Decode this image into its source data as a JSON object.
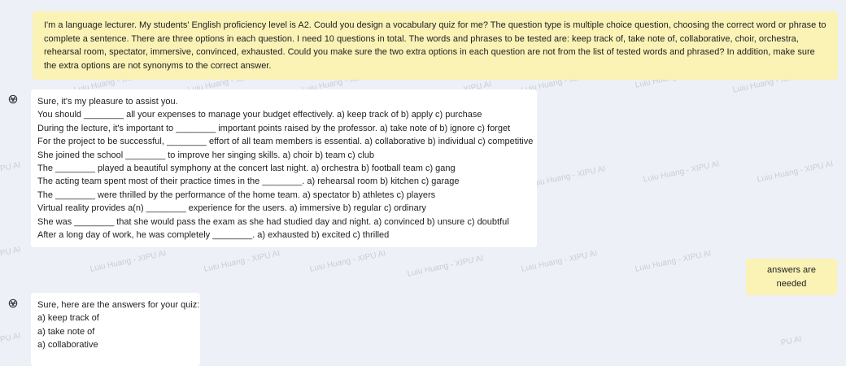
{
  "watermark": {
    "text": "Luiu Huang - XIPU AI",
    "short": "PU AI"
  },
  "messages": {
    "user1": {
      "text": "I'm a language lecturer. My students' English proficiency level is A2. Could you design a vocabulary quiz for me? The question type is multiple choice question, choosing the correct word or phrase to complete a sentence. There are three options in each question. I need 10 questions in total. The words and phrases to be tested are: keep track of, take note of, collaborative, choir, orchestra, rehearsal room, spectator, immersive, convinced, exhausted. Could you make sure the two extra options in each question are not from the list of tested words and phrased? In addition, make sure the extra options are not synonyms to the correct answer."
    },
    "bot1": {
      "lines": [
        "Sure, it's my pleasure to assist you.",
        "You should ________ all your expenses to manage your budget effectively. a) keep track of b) apply c) purchase",
        "During the lecture, it's important to ________ important points raised by the professor. a) take note of b) ignore c) forget",
        "For the project to be successful, ________ effort of all team members is essential. a) collaborative b) individual c) competitive",
        "She joined the school ________ to improve her singing skills. a) choir b) team c) club",
        "The ________ played a beautiful symphony at the concert last night. a) orchestra b) football team c) gang",
        "The acting team spent most of their practice times in the ________. a) rehearsal room b) kitchen c) garage",
        "The ________ were thrilled by the performance of the home team. a) spectator b) athletes c) players",
        "Virtual reality provides a(n) ________ experience for the users. a) immersive b) regular c) ordinary",
        "She was ________ that she would pass the exam as she had studied day and night. a) convinced b) unsure c) doubtful",
        "After a long day of work, he was completely ________. a) exhausted b) excited c) thrilled"
      ]
    },
    "user2": {
      "text": "answers are needed"
    },
    "bot2": {
      "lines": [
        "Sure, here are the answers for your quiz:",
        "a) keep track of",
        "a) take note of",
        "a) collaborative"
      ]
    }
  },
  "icons": {
    "assistant_avatar": "openai-logo-icon"
  }
}
